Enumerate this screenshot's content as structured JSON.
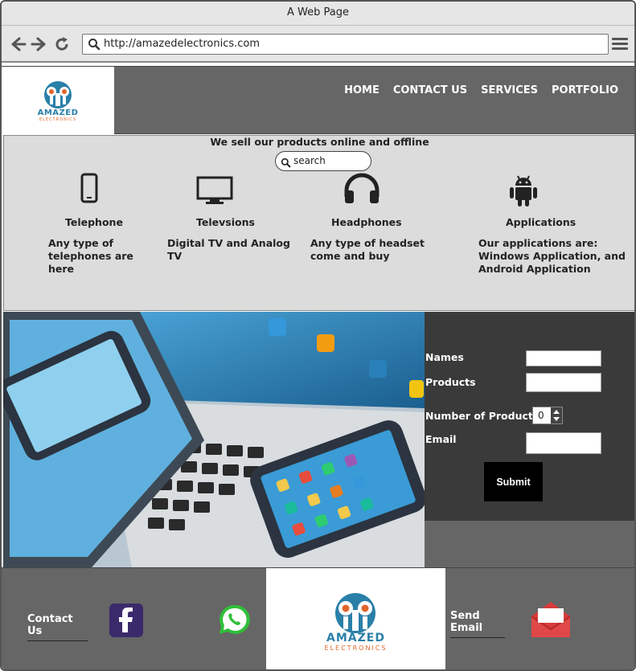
{
  "browser": {
    "window_title": "A Web Page",
    "url": "http://amazedelectronics.com"
  },
  "header": {
    "logo": {
      "brand": "AMAZED",
      "sub": "ELECTRONICS"
    },
    "nav": [
      "HOME",
      "CONTACT US",
      "SERVICES",
      "PORTFOLIO"
    ]
  },
  "products": {
    "tagline": "We sell our products online and offline",
    "search_placeholder": "search",
    "categories": [
      {
        "icon": "smartphone-icon",
        "name": "Telephone",
        "desc_lines": [
          "Any type of",
          "telephones are",
          "here"
        ]
      },
      {
        "icon": "monitor-icon",
        "name": "Televsions",
        "desc_lines": [
          "Digital TV and Analog",
          "TV"
        ]
      },
      {
        "icon": "headphones-icon",
        "name": "Headphones",
        "desc_lines": [
          "Any type of headset",
          "come and buy"
        ]
      },
      {
        "icon": "android-icon",
        "name": "Applications",
        "desc_lines": [
          "Our applications are:",
          "Windows Application, and",
          "Android Application"
        ]
      }
    ]
  },
  "form": {
    "names_label": "Names",
    "products_label": "Products",
    "number_label": "Number of Products",
    "number_value": "0",
    "email_label": "Email",
    "submit_label": "Submit"
  },
  "footer": {
    "contact_label": "Contact Us",
    "send_email_label": "Send Email",
    "logo": {
      "brand": "AMAZED",
      "sub": "ELECTRONICS"
    }
  },
  "colors": {
    "header_bg": "#666666",
    "section_bg": "#dcdcdc",
    "form_bg": "#3a3a3a",
    "facebook": "#3b2a6b",
    "whatsapp": "#2fbf3a",
    "email": "#d93a3a",
    "logo_orange": "#e0662a",
    "logo_teal": "#2a7fa8"
  }
}
